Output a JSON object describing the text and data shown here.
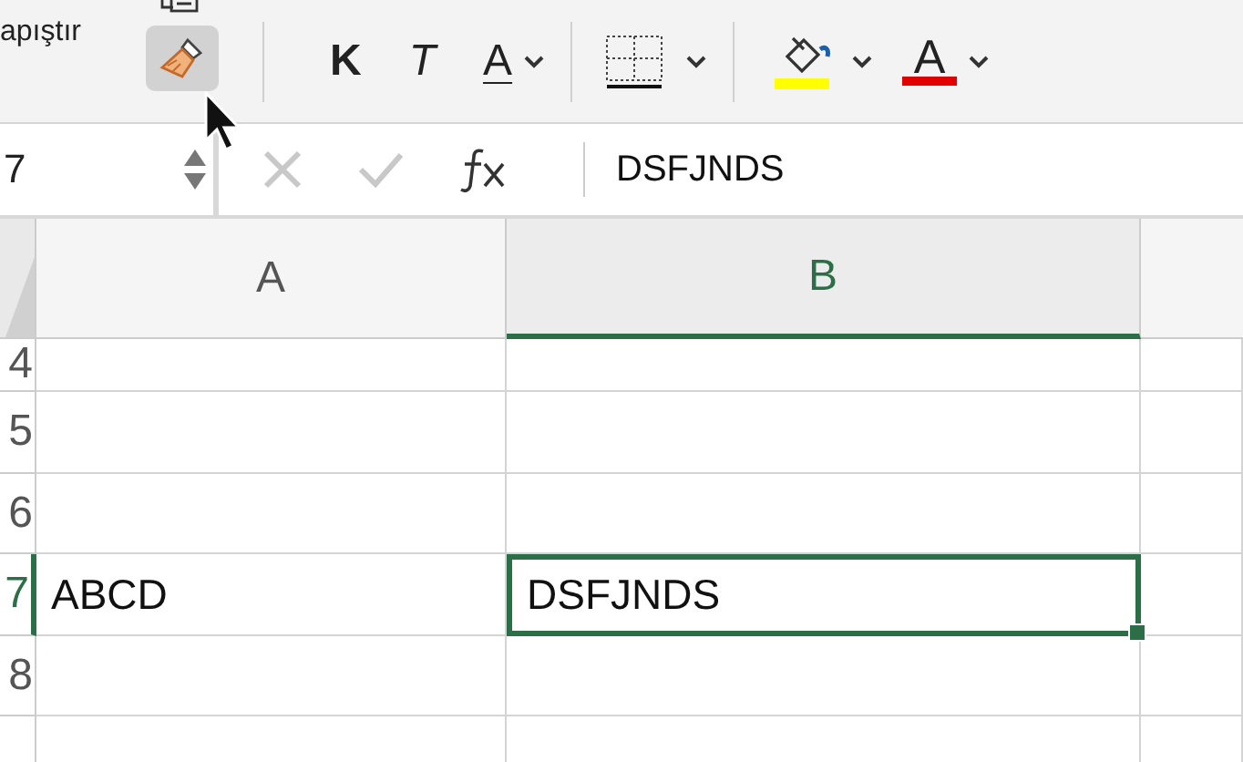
{
  "ribbon": {
    "paste_label": "apıştır",
    "format_painter": {
      "selected": true
    },
    "tools": [
      {
        "kind": "bold",
        "label": "K"
      },
      {
        "kind": "italic",
        "label": "T"
      },
      {
        "kind": "underline",
        "label": "A",
        "dropdown": true
      },
      {
        "kind": "divider"
      },
      {
        "kind": "borders",
        "dropdown": true
      },
      {
        "kind": "divider"
      },
      {
        "kind": "fill",
        "color": "#ffff00",
        "dropdown": true
      },
      {
        "kind": "fontcolor",
        "label": "A",
        "color": "#e00000",
        "dropdown": true
      }
    ]
  },
  "formula_bar": {
    "name_box": "7",
    "formula": "DSFJNDS"
  },
  "sheet": {
    "columns": [
      {
        "label": "A",
        "selected": false
      },
      {
        "label": "B",
        "selected": true
      }
    ],
    "rows": [
      {
        "number": "4",
        "selected": false,
        "cells": [
          {
            "selected": false
          },
          {
            "selected": false
          }
        ]
      },
      {
        "number": "5",
        "selected": false,
        "cells": [
          {
            "selected": false
          },
          {
            "selected": false
          }
        ]
      },
      {
        "number": "6",
        "selected": false,
        "cells": [
          {
            "selected": false
          },
          {
            "selected": false
          }
        ]
      },
      {
        "number": "7",
        "selected": true,
        "cells": [
          {
            "value": "ABCD",
            "selected": false
          },
          {
            "value": "DSFJNDS",
            "selected": true
          }
        ]
      },
      {
        "number": "8",
        "selected": false,
        "cells": [
          {
            "selected": false
          },
          {
            "selected": false
          }
        ]
      },
      {
        "selected": false,
        "cells": [
          {
            "selected": false
          },
          {
            "selected": false
          }
        ]
      }
    ]
  }
}
